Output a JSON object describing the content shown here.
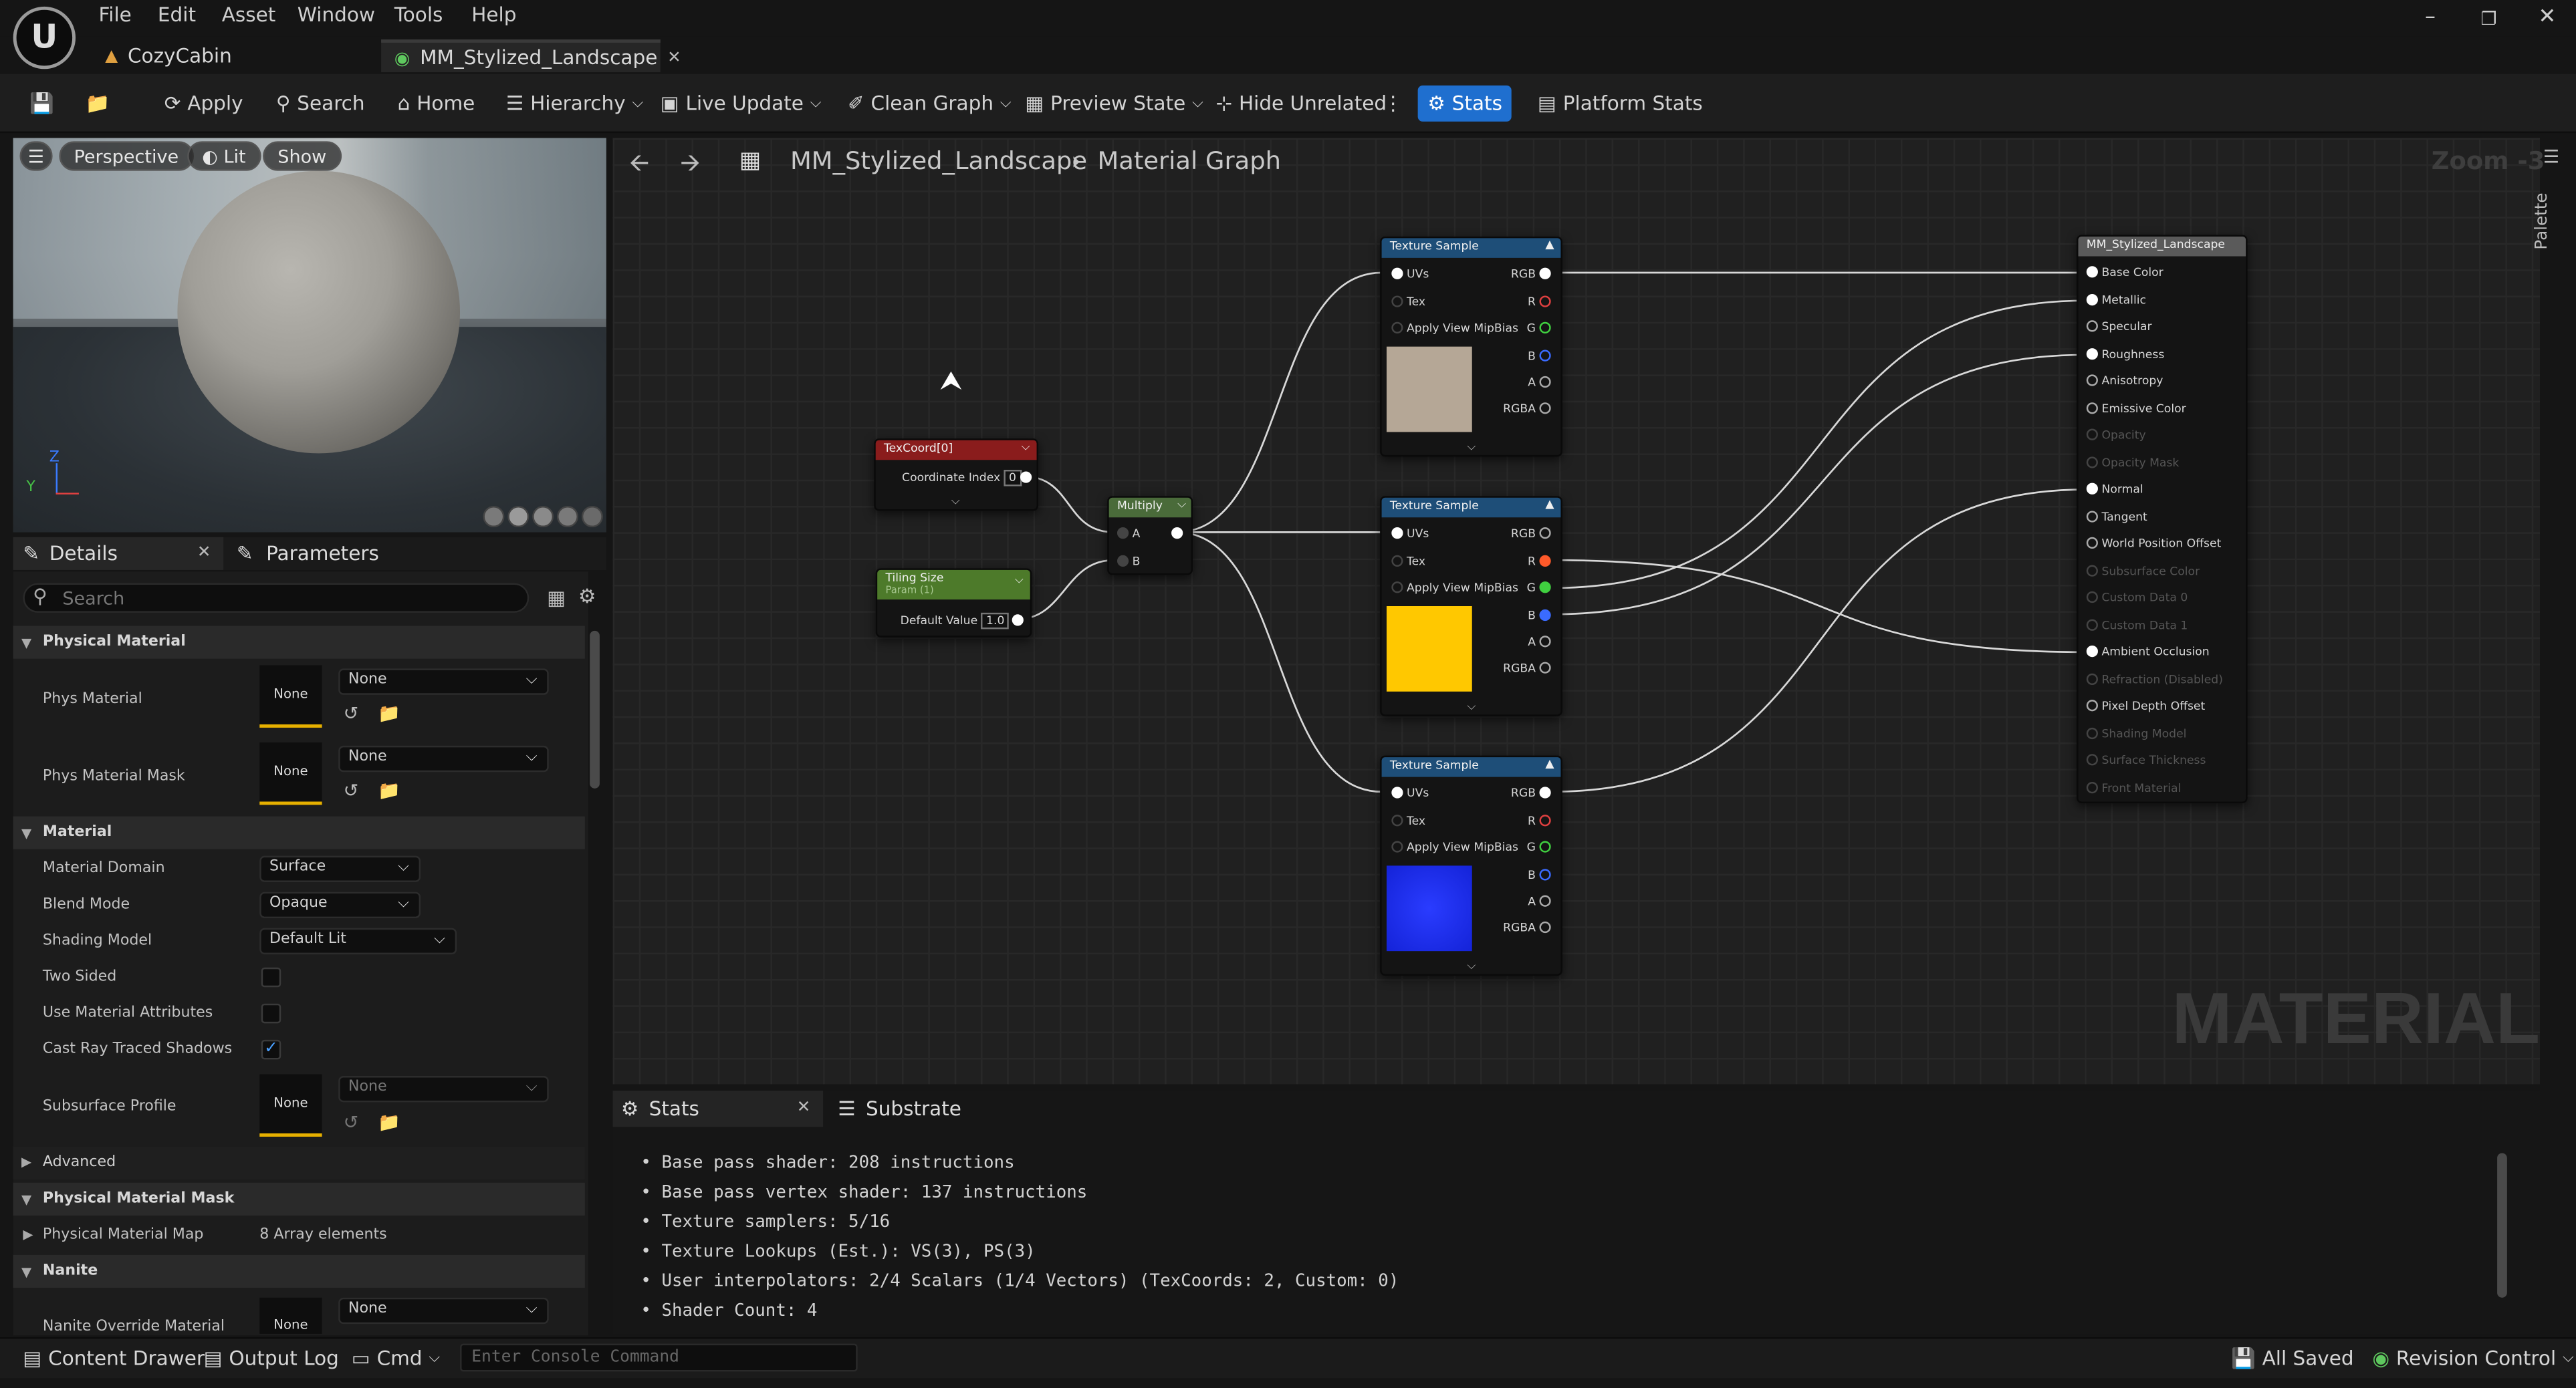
{
  "menu": {
    "items": [
      "File",
      "Edit",
      "Asset",
      "Window",
      "Tools",
      "Help"
    ]
  },
  "tabs": [
    {
      "label": "CozyCabin"
    },
    {
      "label": "MM_Stylized_Landscape"
    }
  ],
  "toolbar": {
    "apply": "Apply",
    "search": "Search",
    "home": "Home",
    "hierarchy": "Hierarchy",
    "live_update": "Live Update",
    "clean_graph": "Clean Graph",
    "preview_state": "Preview State",
    "hide_unrelated": "Hide Unrelated",
    "stats": "Stats",
    "platform_stats": "Platform Stats"
  },
  "viewport": {
    "perspective": "Perspective",
    "lit": "Lit",
    "show": "Show",
    "axis_z": "Z",
    "axis_y": "Y"
  },
  "details_tabs": {
    "details": "Details",
    "parameters": "Parameters"
  },
  "details": {
    "search_placeholder": "Search",
    "sections": {
      "physical_material": "Physical Material",
      "material": "Material",
      "advanced": "Advanced",
      "physical_material_mask": "Physical Material Mask",
      "nanite": "Nanite"
    },
    "phys_material": {
      "label": "Phys Material",
      "thumb": "None",
      "value": "None"
    },
    "phys_material_mask": {
      "label": "Phys Material Mask",
      "thumb": "None",
      "value": "None"
    },
    "material_domain": {
      "label": "Material Domain",
      "value": "Surface"
    },
    "blend_mode": {
      "label": "Blend Mode",
      "value": "Opaque"
    },
    "shading_model": {
      "label": "Shading Model",
      "value": "Default Lit"
    },
    "two_sided": {
      "label": "Two Sided",
      "checked": false
    },
    "use_material_attributes": {
      "label": "Use Material Attributes",
      "checked": false
    },
    "cast_ray_traced_shadows": {
      "label": "Cast Ray Traced Shadows",
      "checked": true
    },
    "subsurface_profile": {
      "label": "Subsurface Profile",
      "thumb": "None",
      "value": "None"
    },
    "physical_material_map": {
      "label": "Physical Material Map",
      "value": "8 Array elements"
    },
    "nanite_override": {
      "label": "Nanite Override Material",
      "thumb": "None",
      "value": "None"
    }
  },
  "graph": {
    "breadcrumb_asset": "MM_Stylized_Landscape",
    "breadcrumb_page": "Material Graph",
    "zoom": "Zoom -3",
    "palette": "Palette",
    "watermark": "MATERIAL",
    "texcoord": {
      "title": "TexCoord[0]",
      "coord_label": "Coordinate Index",
      "coord_value": "0"
    },
    "tiling": {
      "title": "Tiling Size",
      "subtitle": "Param (1)",
      "default_label": "Default Value",
      "default_value": "1.0"
    },
    "multiply": {
      "title": "Multiply",
      "a": "A",
      "b": "B"
    },
    "texture_samples": [
      {
        "title": "Texture Sample",
        "swatch": "#b5a796"
      },
      {
        "title": "Texture Sample",
        "swatch": "#ffc800"
      },
      {
        "title": "Texture Sample",
        "swatch": "#1c2ff0"
      }
    ],
    "ts_inputs": [
      "UVs",
      "Tex",
      "Apply View MipBias"
    ],
    "ts_outputs": [
      "RGB",
      "R",
      "G",
      "B",
      "A",
      "RGBA"
    ],
    "result": {
      "title": "MM_Stylized_Landscape",
      "pins": [
        "Base Color",
        "Metallic",
        "Specular",
        "Roughness",
        "Anisotropy",
        "Emissive Color",
        "Opacity",
        "Opacity Mask",
        "Normal",
        "Tangent",
        "World Position Offset",
        "Subsurface Color",
        "Custom Data 0",
        "Custom Data 1",
        "Ambient Occlusion",
        "Refraction (Disabled)",
        "Pixel Depth Offset",
        "Shading Model",
        "Surface Thickness",
        "Front Material"
      ]
    }
  },
  "bottom_tabs": {
    "stats": "Stats",
    "substrate": "Substrate"
  },
  "stats_lines": [
    "Base pass shader: 208 instructions",
    "Base pass vertex shader: 137 instructions",
    "Texture samplers: 5/16",
    "Texture Lookups (Est.): VS(3), PS(3)",
    "User interpolators: 2/4 Scalars (1/4 Vectors) (TexCoords: 2, Custom: 0)",
    "Shader Count: 4"
  ],
  "bottombar": {
    "content_drawer": "Content Drawer",
    "output_log": "Output Log",
    "cmd": "Cmd",
    "console_placeholder": "Enter Console Command",
    "all_saved": "All Saved",
    "revision_control": "Revision Control"
  },
  "colors": {
    "accent": "#1f6fcf",
    "texcoord_head": "#8a1c1c",
    "tiling_head": "#4d7a2a",
    "multiply_head": "#4a6b3a",
    "texture_head": "#1e4e78",
    "result_head": "#5a5a5a"
  }
}
